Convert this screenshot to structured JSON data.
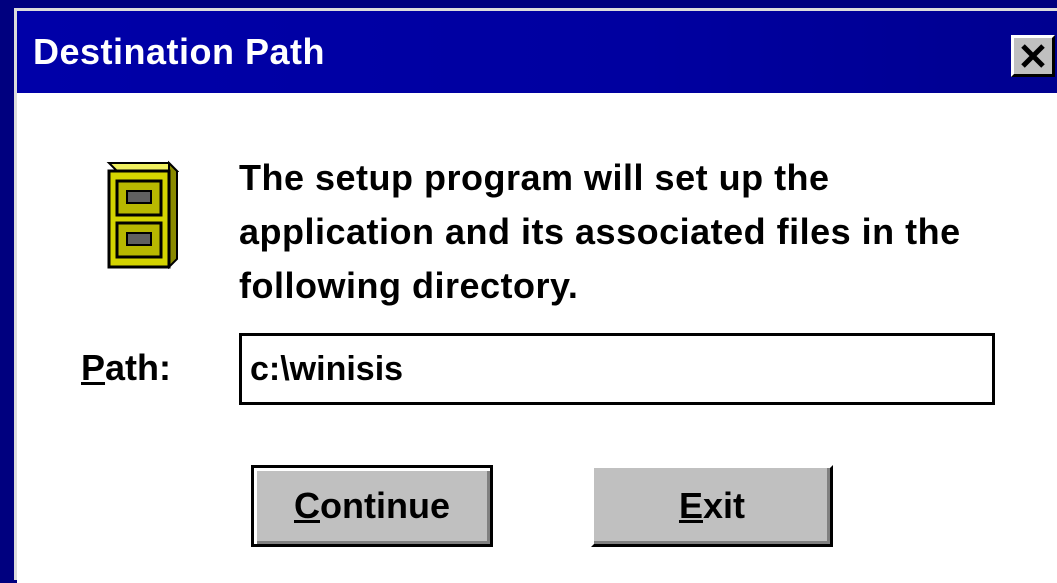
{
  "dialog": {
    "title": "Destination Path",
    "close_icon": "close-icon",
    "message": "The setup program will set up the application and its associated files in the following directory.",
    "path_label_first": "P",
    "path_label_rest": "ath:",
    "path_value": "c:\\winisis",
    "continue_first": "C",
    "continue_rest": "ontinue",
    "exit_first": "E",
    "exit_rest": "xit"
  },
  "colors": {
    "titlebar": "#0000a8",
    "button_face": "#c0c0c0",
    "background": "#00007f",
    "cabinet_yellow": "#d4d400"
  },
  "icons": {
    "cabinet": "file-cabinet-icon"
  }
}
